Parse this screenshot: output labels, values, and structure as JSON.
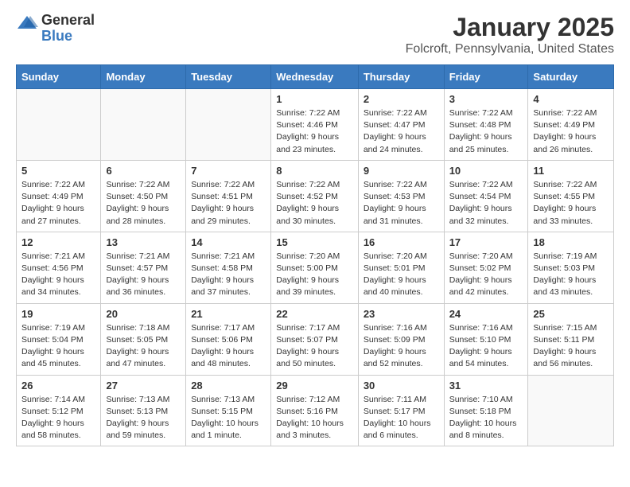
{
  "logo": {
    "general": "General",
    "blue": "Blue"
  },
  "header": {
    "month": "January 2025",
    "location": "Folcroft, Pennsylvania, United States"
  },
  "weekdays": [
    "Sunday",
    "Monday",
    "Tuesday",
    "Wednesday",
    "Thursday",
    "Friday",
    "Saturday"
  ],
  "weeks": [
    [
      {
        "day": "",
        "info": ""
      },
      {
        "day": "",
        "info": ""
      },
      {
        "day": "",
        "info": ""
      },
      {
        "day": "1",
        "info": "Sunrise: 7:22 AM\nSunset: 4:46 PM\nDaylight: 9 hours\nand 23 minutes."
      },
      {
        "day": "2",
        "info": "Sunrise: 7:22 AM\nSunset: 4:47 PM\nDaylight: 9 hours\nand 24 minutes."
      },
      {
        "day": "3",
        "info": "Sunrise: 7:22 AM\nSunset: 4:48 PM\nDaylight: 9 hours\nand 25 minutes."
      },
      {
        "day": "4",
        "info": "Sunrise: 7:22 AM\nSunset: 4:49 PM\nDaylight: 9 hours\nand 26 minutes."
      }
    ],
    [
      {
        "day": "5",
        "info": "Sunrise: 7:22 AM\nSunset: 4:49 PM\nDaylight: 9 hours\nand 27 minutes."
      },
      {
        "day": "6",
        "info": "Sunrise: 7:22 AM\nSunset: 4:50 PM\nDaylight: 9 hours\nand 28 minutes."
      },
      {
        "day": "7",
        "info": "Sunrise: 7:22 AM\nSunset: 4:51 PM\nDaylight: 9 hours\nand 29 minutes."
      },
      {
        "day": "8",
        "info": "Sunrise: 7:22 AM\nSunset: 4:52 PM\nDaylight: 9 hours\nand 30 minutes."
      },
      {
        "day": "9",
        "info": "Sunrise: 7:22 AM\nSunset: 4:53 PM\nDaylight: 9 hours\nand 31 minutes."
      },
      {
        "day": "10",
        "info": "Sunrise: 7:22 AM\nSunset: 4:54 PM\nDaylight: 9 hours\nand 32 minutes."
      },
      {
        "day": "11",
        "info": "Sunrise: 7:22 AM\nSunset: 4:55 PM\nDaylight: 9 hours\nand 33 minutes."
      }
    ],
    [
      {
        "day": "12",
        "info": "Sunrise: 7:21 AM\nSunset: 4:56 PM\nDaylight: 9 hours\nand 34 minutes."
      },
      {
        "day": "13",
        "info": "Sunrise: 7:21 AM\nSunset: 4:57 PM\nDaylight: 9 hours\nand 36 minutes."
      },
      {
        "day": "14",
        "info": "Sunrise: 7:21 AM\nSunset: 4:58 PM\nDaylight: 9 hours\nand 37 minutes."
      },
      {
        "day": "15",
        "info": "Sunrise: 7:20 AM\nSunset: 5:00 PM\nDaylight: 9 hours\nand 39 minutes."
      },
      {
        "day": "16",
        "info": "Sunrise: 7:20 AM\nSunset: 5:01 PM\nDaylight: 9 hours\nand 40 minutes."
      },
      {
        "day": "17",
        "info": "Sunrise: 7:20 AM\nSunset: 5:02 PM\nDaylight: 9 hours\nand 42 minutes."
      },
      {
        "day": "18",
        "info": "Sunrise: 7:19 AM\nSunset: 5:03 PM\nDaylight: 9 hours\nand 43 minutes."
      }
    ],
    [
      {
        "day": "19",
        "info": "Sunrise: 7:19 AM\nSunset: 5:04 PM\nDaylight: 9 hours\nand 45 minutes."
      },
      {
        "day": "20",
        "info": "Sunrise: 7:18 AM\nSunset: 5:05 PM\nDaylight: 9 hours\nand 47 minutes."
      },
      {
        "day": "21",
        "info": "Sunrise: 7:17 AM\nSunset: 5:06 PM\nDaylight: 9 hours\nand 48 minutes."
      },
      {
        "day": "22",
        "info": "Sunrise: 7:17 AM\nSunset: 5:07 PM\nDaylight: 9 hours\nand 50 minutes."
      },
      {
        "day": "23",
        "info": "Sunrise: 7:16 AM\nSunset: 5:09 PM\nDaylight: 9 hours\nand 52 minutes."
      },
      {
        "day": "24",
        "info": "Sunrise: 7:16 AM\nSunset: 5:10 PM\nDaylight: 9 hours\nand 54 minutes."
      },
      {
        "day": "25",
        "info": "Sunrise: 7:15 AM\nSunset: 5:11 PM\nDaylight: 9 hours\nand 56 minutes."
      }
    ],
    [
      {
        "day": "26",
        "info": "Sunrise: 7:14 AM\nSunset: 5:12 PM\nDaylight: 9 hours\nand 58 minutes."
      },
      {
        "day": "27",
        "info": "Sunrise: 7:13 AM\nSunset: 5:13 PM\nDaylight: 9 hours\nand 59 minutes."
      },
      {
        "day": "28",
        "info": "Sunrise: 7:13 AM\nSunset: 5:15 PM\nDaylight: 10 hours\nand 1 minute."
      },
      {
        "day": "29",
        "info": "Sunrise: 7:12 AM\nSunset: 5:16 PM\nDaylight: 10 hours\nand 3 minutes."
      },
      {
        "day": "30",
        "info": "Sunrise: 7:11 AM\nSunset: 5:17 PM\nDaylight: 10 hours\nand 6 minutes."
      },
      {
        "day": "31",
        "info": "Sunrise: 7:10 AM\nSunset: 5:18 PM\nDaylight: 10 hours\nand 8 minutes."
      },
      {
        "day": "",
        "info": ""
      }
    ]
  ]
}
